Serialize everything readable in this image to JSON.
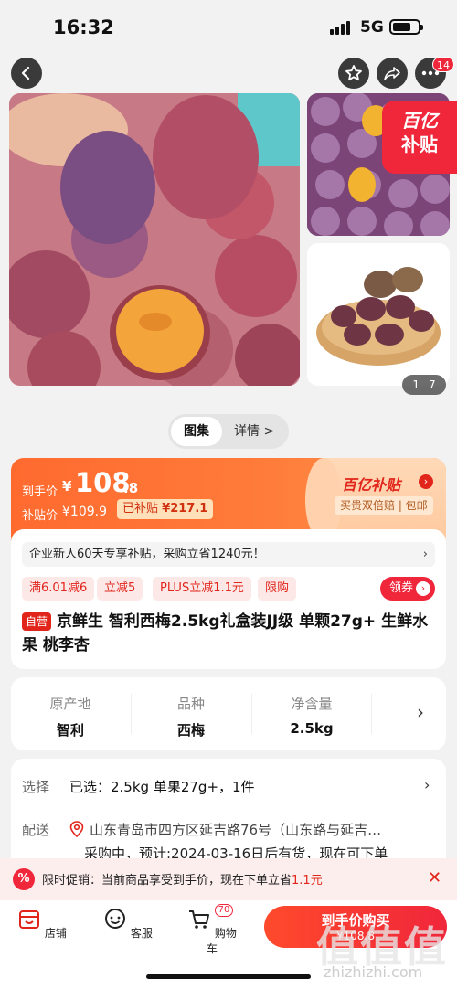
{
  "status": {
    "time": "16:32",
    "network": "5G"
  },
  "nav": {
    "badge": "14"
  },
  "gallery": {
    "subsidy_tag_line1": "百亿",
    "subsidy_tag_line2": "补贴",
    "page_current": "1",
    "page_total": "7"
  },
  "tabs": {
    "active": "图集",
    "other": "详情 >"
  },
  "price": {
    "hand_label": "到手价",
    "yen": "¥",
    "hand_int": "108",
    "hand_dec": ".8",
    "subsidy_label": "补贴价",
    "subsidy_value": "¥109.9",
    "already_label": "已补贴",
    "already_value": "¥217.1",
    "brand_title": "百亿补贴",
    "brand_sub": "买贵双倍赔 | 包邮"
  },
  "product": {
    "notice": "企业新人60天专享补贴，采购立省1240元！",
    "promos": [
      "满6.01减6",
      "立减5",
      "PLUS立减1.1元",
      "限购"
    ],
    "coupon_label": "领券",
    "self_badge": "自营",
    "title": "京鲜生 智利西梅2.5kg礼盒装JJ级 单颗27g+ 生鲜水果 桃李杏"
  },
  "specs": [
    {
      "key": "原产地",
      "value": "智利"
    },
    {
      "key": "品种",
      "value": "西梅"
    },
    {
      "key": "净含量",
      "value": "2.5kg"
    }
  ],
  "select": {
    "choose_label": "选择",
    "choose_value": "已选：2.5kg 单果27g+，1件",
    "ship_label": "配送",
    "ship_address": "山东青岛市四方区延吉路76号（山东路与延吉…",
    "ship_note": "采购中，预计:2024-03-16日后有货，现在可下单"
  },
  "promo_bar": {
    "icon": "%",
    "text": "限时促销：当前商品享受到手价，现在下单立省",
    "highlight": "1.1元"
  },
  "bottom": {
    "shop": "店铺",
    "service": "客服",
    "cart": "购物车",
    "cart_count": "70",
    "buy_line1": "到手价购买",
    "buy_line2": "¥108.8"
  },
  "watermark": {
    "text": "值值值",
    "url": "zhizhizhi.com"
  },
  "colors": {
    "accent": "#f0263b",
    "orange": "#ff6a2f"
  }
}
